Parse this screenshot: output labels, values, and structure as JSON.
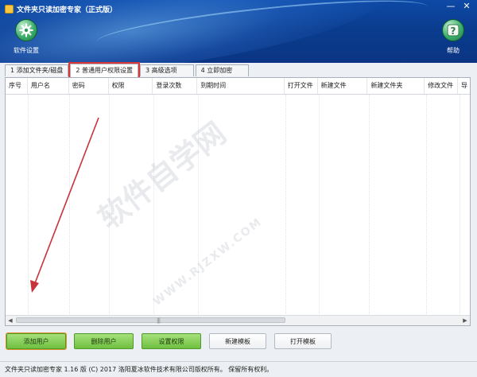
{
  "window": {
    "title": "文件夹只读加密专家（正式版）",
    "controls": {
      "minimize": "—",
      "close": "✕"
    }
  },
  "toolbar": {
    "settings_label": "软件设置",
    "help_label": "帮助"
  },
  "tabs": [
    {
      "label": "1 添加文件夹/磁盘"
    },
    {
      "label": "2 普通用户权限设置"
    },
    {
      "label": "3 高级选项"
    },
    {
      "label": "4 立即加密"
    }
  ],
  "table": {
    "columns": [
      "序号",
      "用户名",
      "密码",
      "权限",
      "登录次数",
      "到期时间",
      "打开文件",
      "新建文件",
      "新建文件夹",
      "修改文件",
      "导"
    ],
    "rows": []
  },
  "scrollbar": {
    "left_arrow": "◀",
    "right_arrow": "▶",
    "grip": "|||"
  },
  "buttons": {
    "add_user": "添加用户",
    "delete_user": "删除用户",
    "set_permission": "设置权限",
    "new_template": "新建模板",
    "open_template": "打开模板"
  },
  "status": "文件夹只读加密专家 1.16 版  (C)  2017 洛阳夏冰软件技术有限公司版权所有。 保留所有权利。",
  "watermark": {
    "text": "软件自学网",
    "url": "WWW.RJZXW.COM"
  },
  "colors": {
    "header": "#0b3c8f",
    "accent_green": "#6fc040",
    "highlight_red": "#d9373b"
  }
}
